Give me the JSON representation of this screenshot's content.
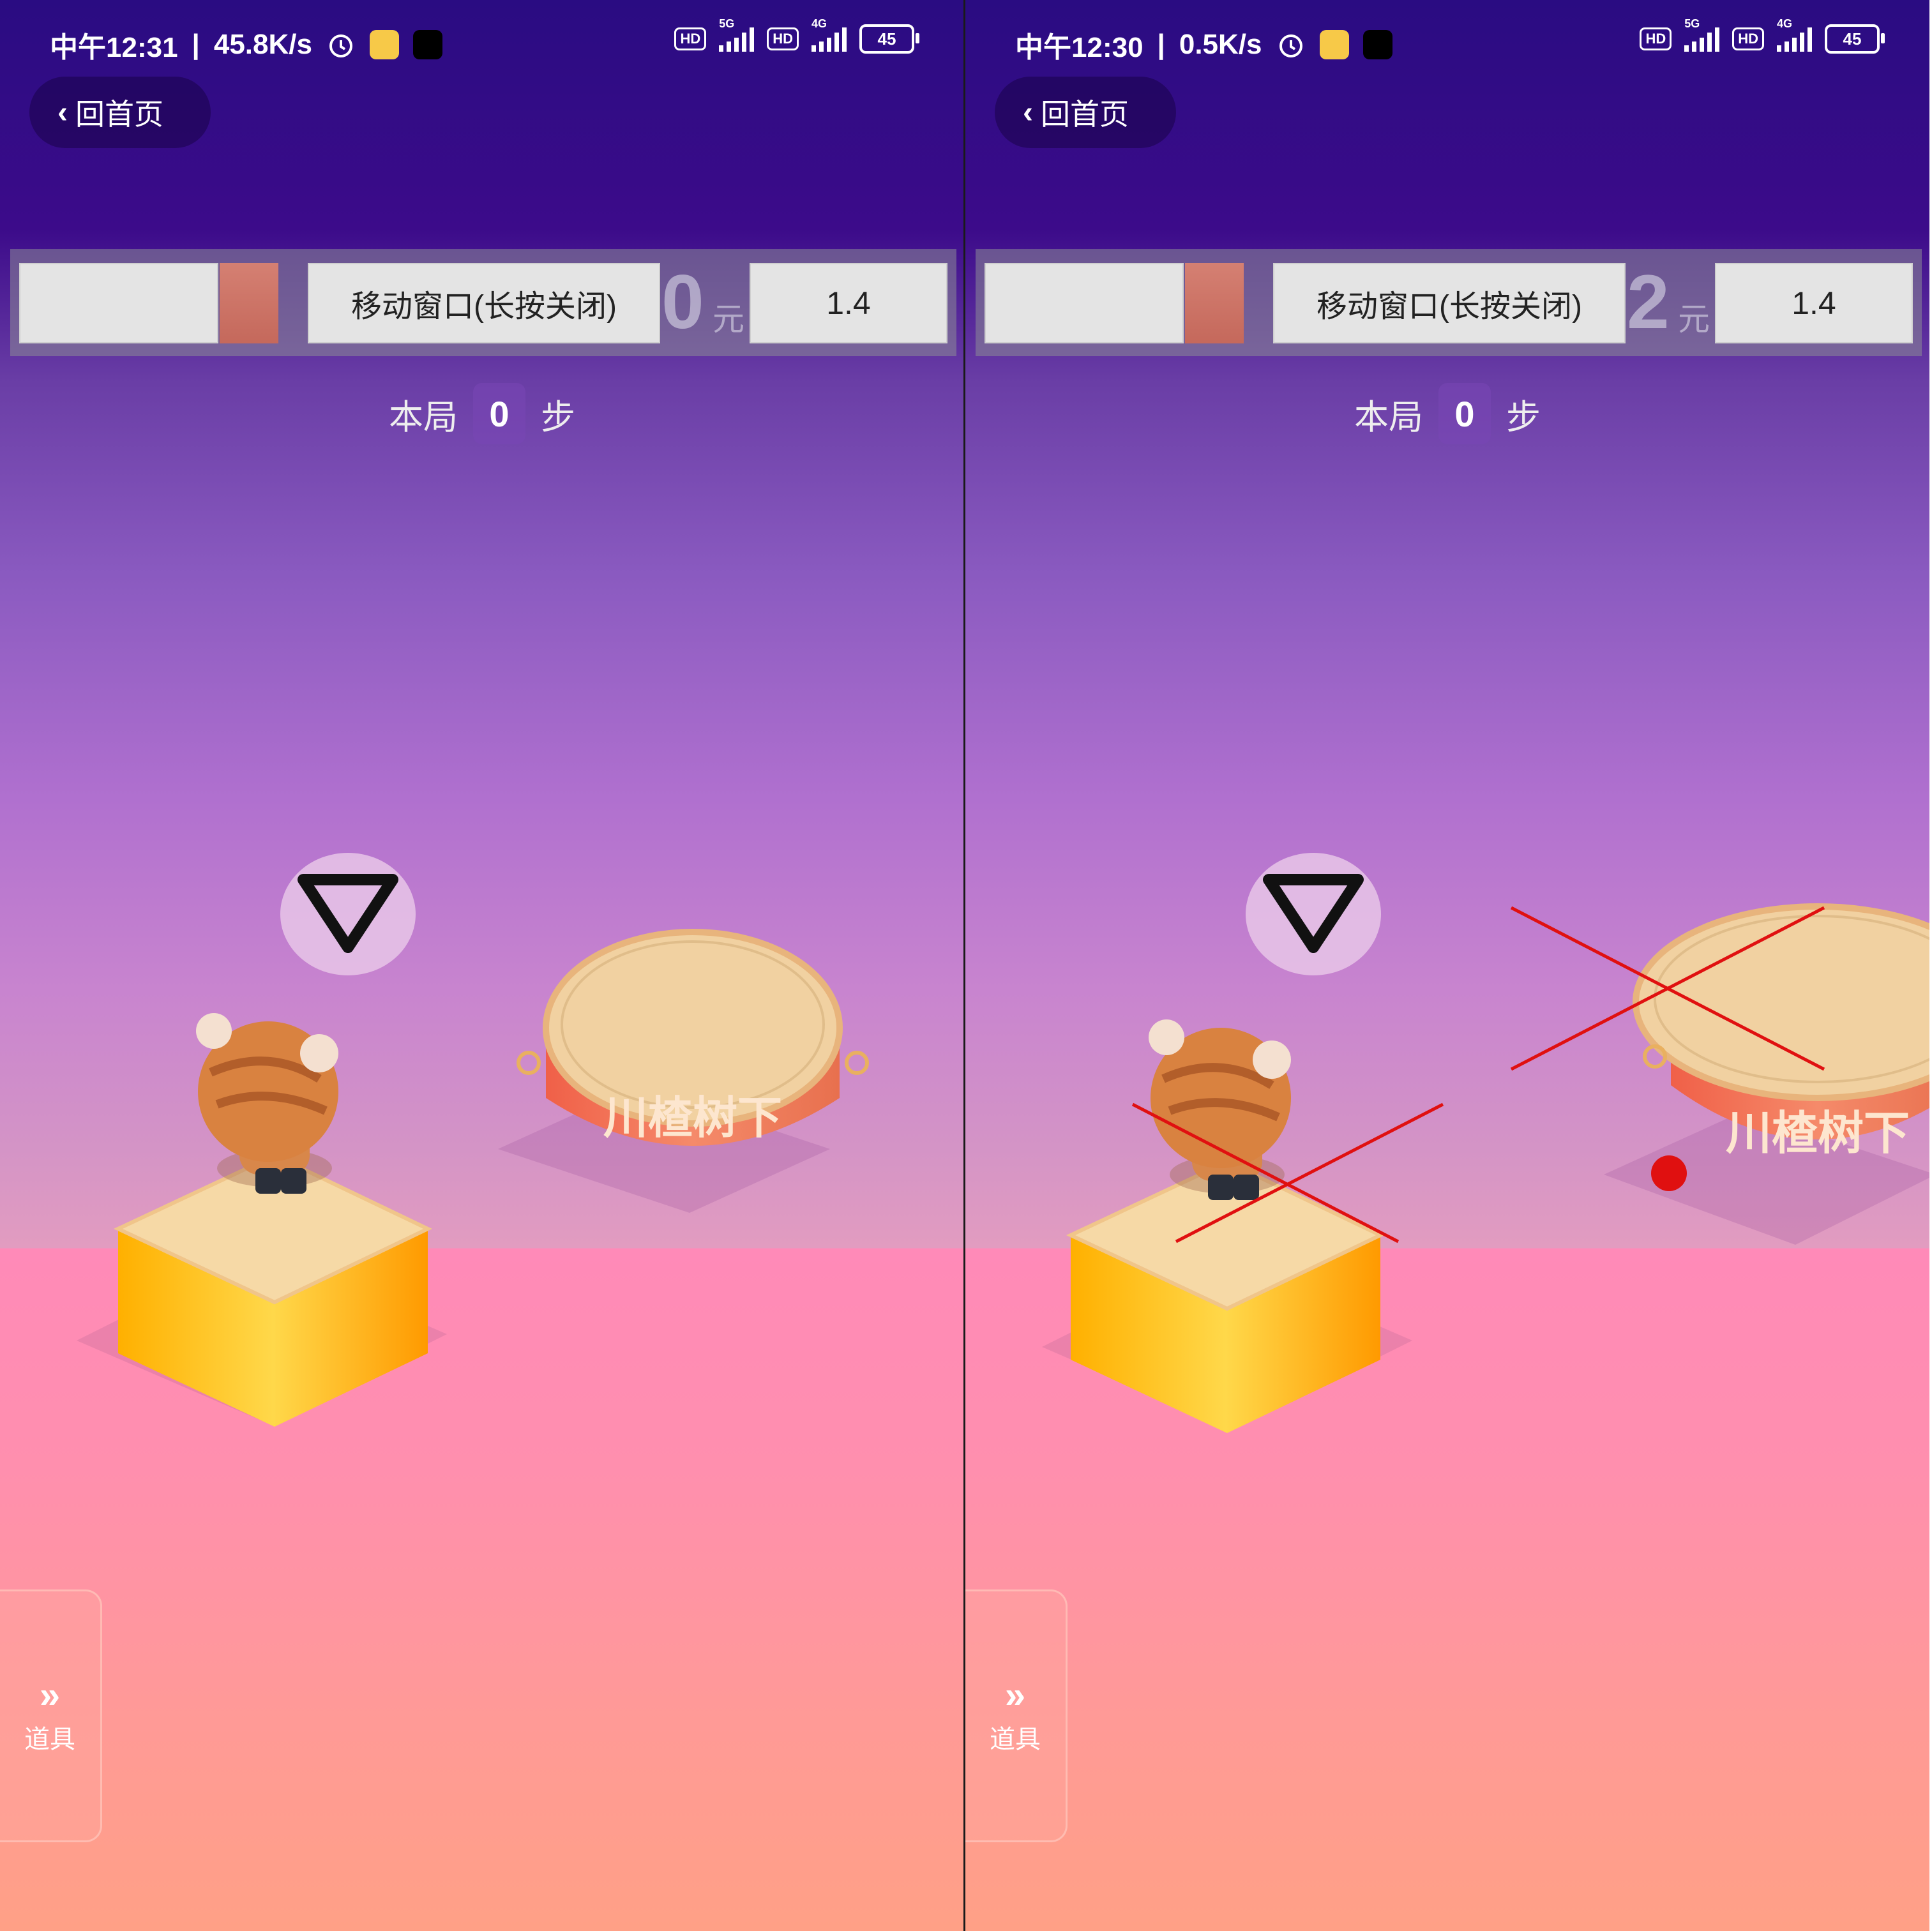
{
  "panels": [
    {
      "status": {
        "time": "中午12:31",
        "speed": "45.8K/s",
        "battery": "45",
        "hd": "HD",
        "net1": "5G",
        "net2": "4G"
      },
      "nav": {
        "back_label": "回首页"
      },
      "overlay": {
        "move_window_label": "移动窗口(长按关闭)",
        "value": "1.4",
        "ghost_digit": "0",
        "ghost_unit": "元"
      },
      "steps": {
        "prefix": "本局",
        "count": "0",
        "suffix": "步"
      },
      "drum": {
        "text": "川楂树下"
      },
      "tools": {
        "label": "道具"
      }
    },
    {
      "status": {
        "time": "中午12:30",
        "speed": "0.5K/s",
        "battery": "45",
        "hd": "HD",
        "net1": "5G",
        "net2": "4G"
      },
      "nav": {
        "back_label": "回首页"
      },
      "overlay": {
        "move_window_label": "移动窗口(长按关闭)",
        "value": "1.4",
        "ghost_digit": "2",
        "ghost_unit": "元"
      },
      "steps": {
        "prefix": "本局",
        "count": "0",
        "suffix": "步"
      },
      "drum": {
        "text": "川楂树下"
      },
      "tools": {
        "label": "道具"
      }
    }
  ],
  "icons": {
    "back": "chevron-left-icon",
    "alarm": "alarm-icon",
    "tools": "double-chevron-right-icon",
    "triangle": "down-triangle-icon"
  },
  "colors": {
    "annotation_red": "#e01010",
    "accent_purple": "#3c0b8a",
    "floor_pink": "#ff8fae"
  }
}
